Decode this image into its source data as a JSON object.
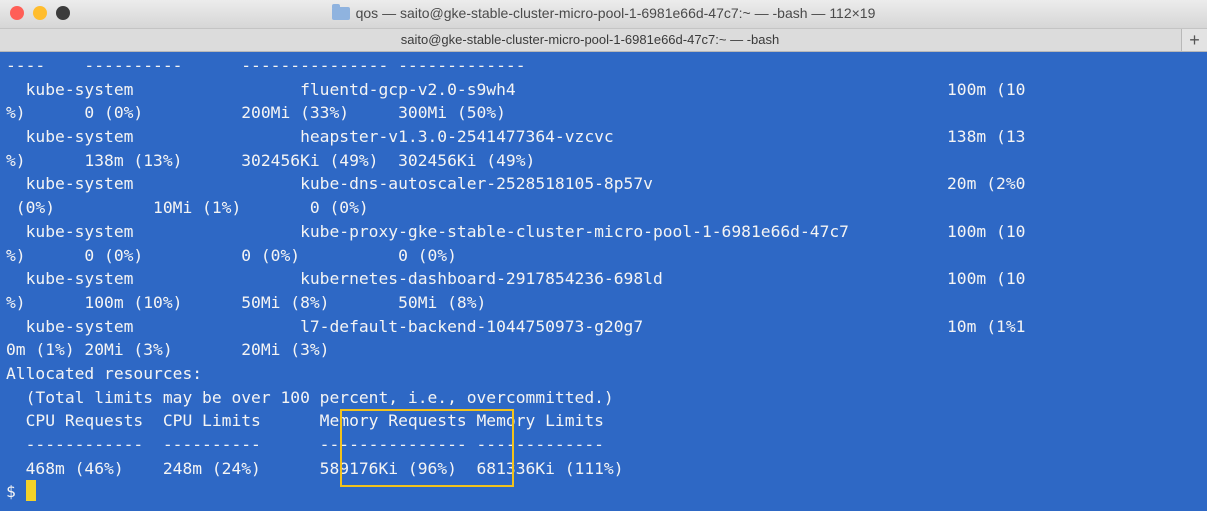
{
  "colors": {
    "terminal_bg": "#2e68c5",
    "terminal_fg": "#f4f4f4",
    "highlight": "#f2c21b",
    "cursor": "#f2d22a",
    "close": "#ff5f57",
    "minimize": "#ffbd2e",
    "zoom": "#3c3c3c"
  },
  "window": {
    "title": "qos — saito@gke-stable-cluster-micro-pool-1-6981e66d-47c7:~ — -bash — 112×19",
    "title_icon": "folder-icon",
    "tab_label": "saito@gke-stable-cluster-micro-pool-1-6981e66d-47c7:~ — -bash",
    "new_tab_label": "+"
  },
  "terminal": {
    "lines": [
      "----    ----------      --------------- -------------",
      "  kube-system                 fluentd-gcp-v2.0-s9wh4                                            100m (10",
      "%)      0 (0%)          200Mi (33%)     300Mi (50%)",
      "  kube-system                 heapster-v1.3.0-2541477364-vzcvc                                  138m (13",
      "%)      138m (13%)      302456Ki (49%)  302456Ki (49%)",
      "  kube-system                 kube-dns-autoscaler-2528518105-8p57v                              20m (2%0",
      " (0%)          10Mi (1%)       0 (0%)",
      "  kube-system                 kube-proxy-gke-stable-cluster-micro-pool-1-6981e66d-47c7          100m (10",
      "%)      0 (0%)          0 (0%)          0 (0%)",
      "  kube-system                 kubernetes-dashboard-2917854236-698ld                             100m (10",
      "%)      100m (10%)      50Mi (8%)       50Mi (8%)",
      "  kube-system                 l7-default-backend-1044750973-g20g7                               10m (1%1",
      "0m (1%) 20Mi (3%)       20Mi (3%)",
      "Allocated resources:",
      "  (Total limits may be over 100 percent, i.e., overcommitted.)",
      "  CPU Requests  CPU Limits      Memory Requests Memory Limits",
      "  ------------  ----------      --------------- -------------",
      "  468m (46%)    248m (24%)      589176Ki (96%)  681336Ki (111%)"
    ],
    "prompt": "$ "
  }
}
